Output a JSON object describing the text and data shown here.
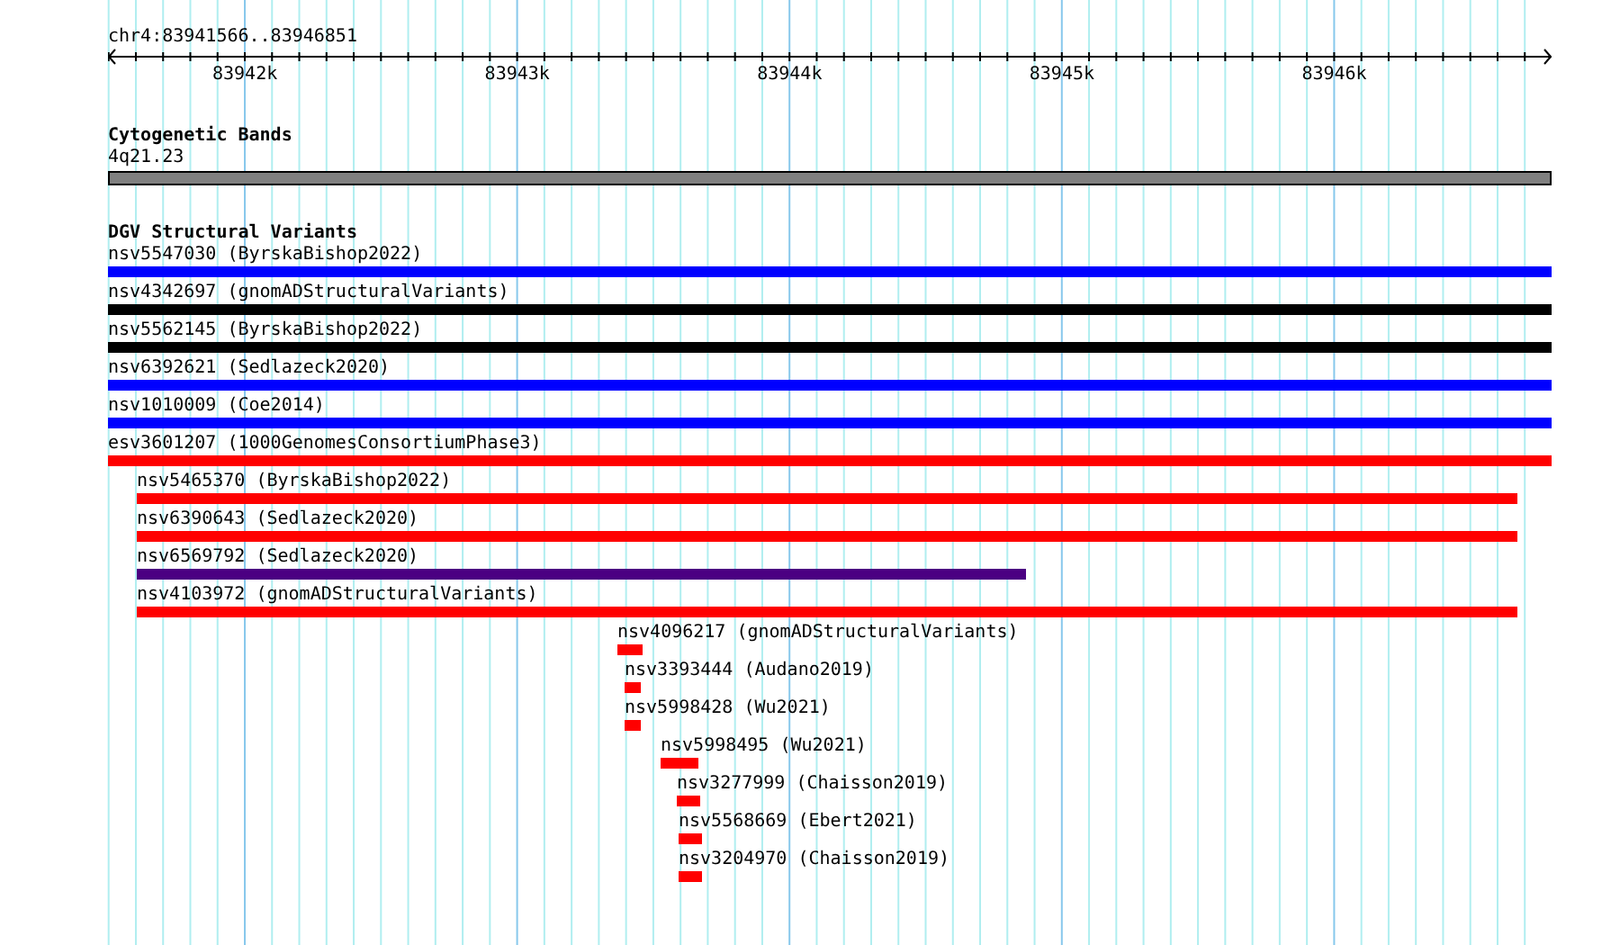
{
  "ruler": {
    "title": "chr4:83941566..83946851",
    "ticks": [
      "83942k",
      "83943k",
      "83944k",
      "83945k",
      "83946k"
    ]
  },
  "cytogenetic_bands": {
    "title": "Cytogenetic Bands",
    "band": "4q21.23"
  },
  "dgv_structural_variants": {
    "title": "DGV Structural Variants",
    "features": [
      {
        "label": "nsv5547030 (ByrskaBishop2022)",
        "color": "#0000ff"
      },
      {
        "label": "nsv4342697 (gnomADStructuralVariants)",
        "color": "#000000"
      },
      {
        "label": "nsv5562145 (ByrskaBishop2022)",
        "color": "#000000"
      },
      {
        "label": "nsv6392621 (Sedlazeck2020)",
        "color": "#0000ff"
      },
      {
        "label": "nsv1010009 (Coe2014)",
        "color": "#0000ff"
      },
      {
        "label": "esv3601207 (1000GenomesConsortiumPhase3)",
        "color": "#ff0000"
      },
      {
        "label": "nsv5465370 (ByrskaBishop2022)",
        "color": "#ff0000"
      },
      {
        "label": "nsv6390643 (Sedlazeck2020)",
        "color": "#ff0000"
      },
      {
        "label": "nsv6569792 (Sedlazeck2020)",
        "color": "#4b0082"
      },
      {
        "label": "nsv4103972 (gnomADStructuralVariants)",
        "color": "#ff0000"
      },
      {
        "label": "nsv4096217 (gnomADStructuralVariants)",
        "color": "#ff0000"
      },
      {
        "label": "nsv3393444 (Audano2019)",
        "color": "#ff0000"
      },
      {
        "label": "nsv5998428 (Wu2021)",
        "color": "#ff0000"
      },
      {
        "label": "nsv5998495 (Wu2021)",
        "color": "#ff0000"
      },
      {
        "label": "nsv3277999 (Chaisson2019)",
        "color": "#ff0000"
      },
      {
        "label": "nsv5568669 (Ebert2021)",
        "color": "#ff0000"
      },
      {
        "label": "nsv3204970 (Chaisson2019)",
        "color": "#ff0000"
      }
    ]
  }
}
